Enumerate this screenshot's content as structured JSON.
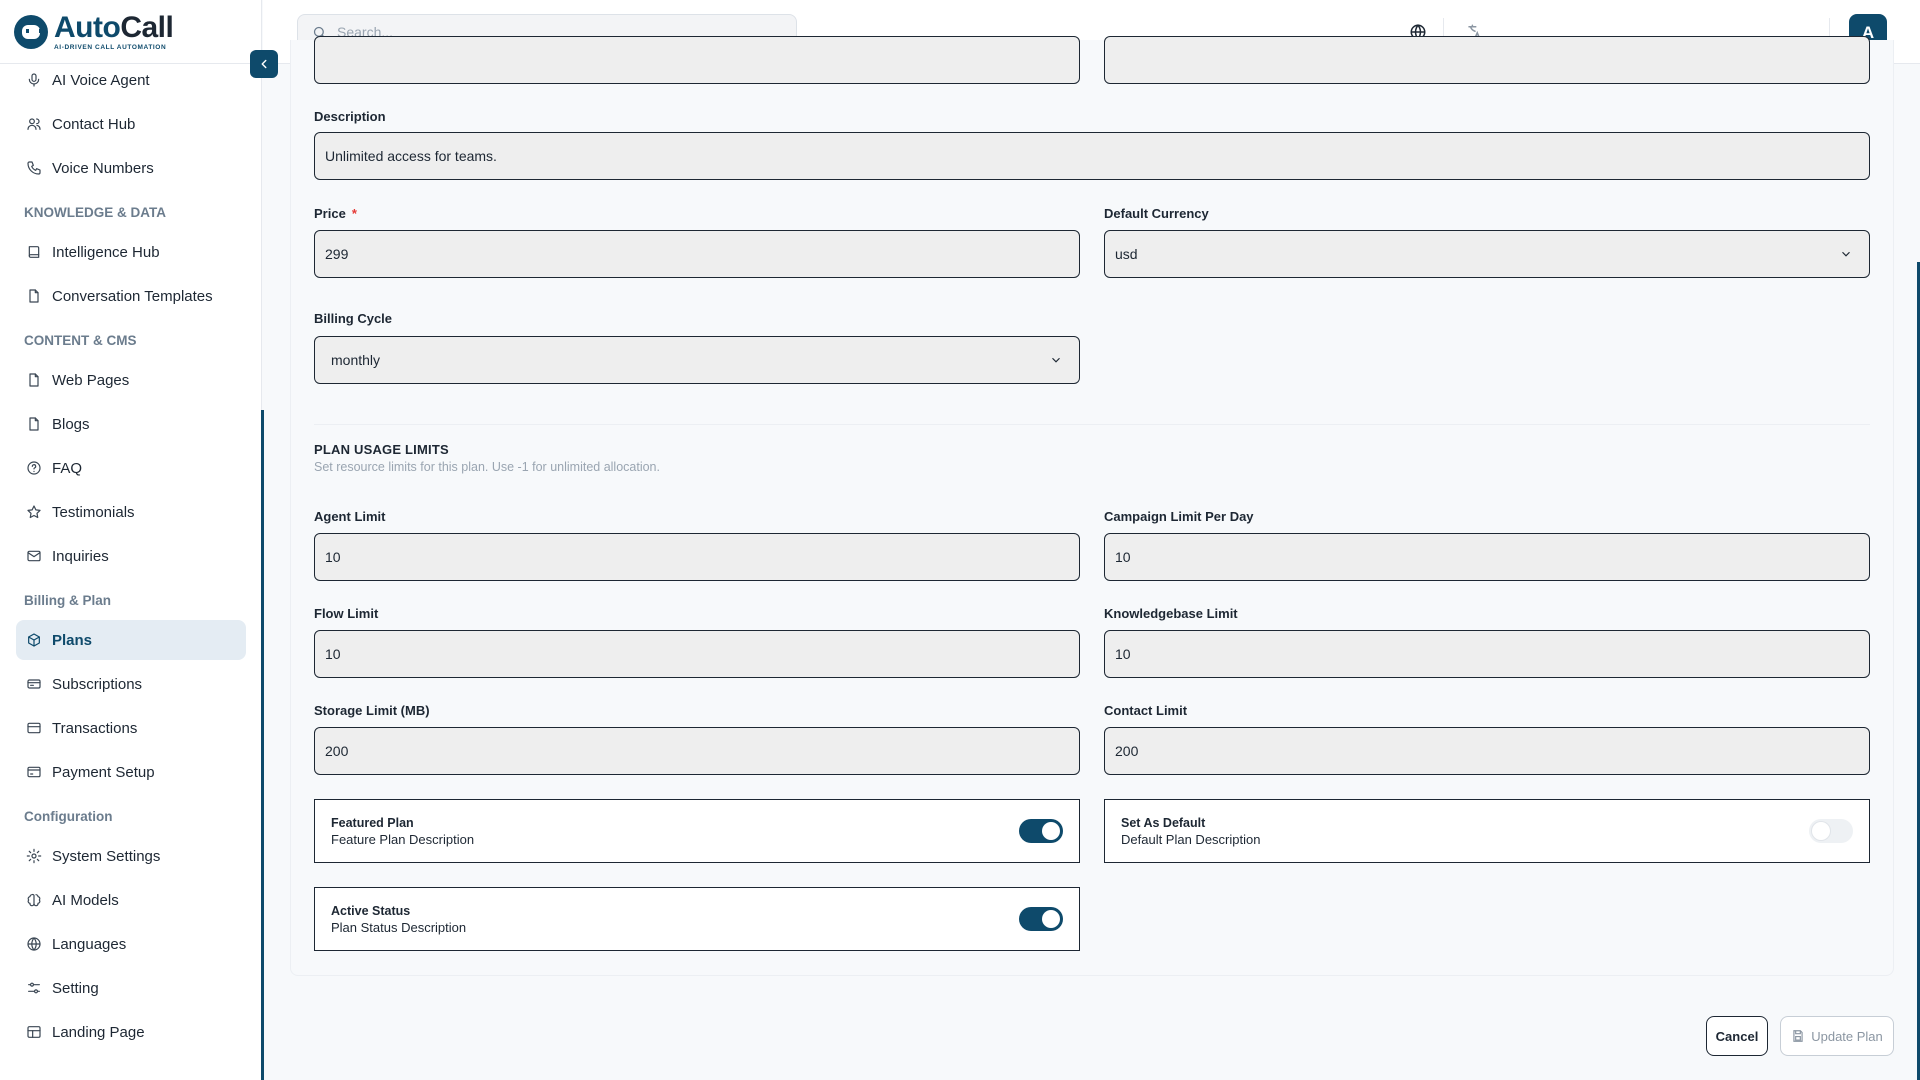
{
  "brand": {
    "name_a": "Auto",
    "name_b": "Call",
    "tagline": "AI-DRIVEN CALL AUTOMATION"
  },
  "search": {
    "placeholder": "Search..."
  },
  "user": {
    "avatar_letter": "A"
  },
  "sidebar": {
    "items": [
      {
        "type": "item",
        "label": "AI Voice Agent",
        "icon": "mic-icon"
      },
      {
        "type": "item",
        "label": "Contact Hub",
        "icon": "users-icon"
      },
      {
        "type": "item",
        "label": "Voice Numbers",
        "icon": "phone-icon"
      },
      {
        "type": "section",
        "label": "KNOWLEDGE & DATA"
      },
      {
        "type": "item",
        "label": "Intelligence Hub",
        "icon": "book-icon"
      },
      {
        "type": "item",
        "label": "Conversation Templates",
        "icon": "file-icon"
      },
      {
        "type": "section",
        "label": "CONTENT & CMS"
      },
      {
        "type": "item",
        "label": "Web Pages",
        "icon": "file-icon"
      },
      {
        "type": "item",
        "label": "Blogs",
        "icon": "file-icon"
      },
      {
        "type": "item",
        "label": "FAQ",
        "icon": "help-circle-icon"
      },
      {
        "type": "item",
        "label": "Testimonials",
        "icon": "star-icon"
      },
      {
        "type": "item",
        "label": "Inquiries",
        "icon": "mail-icon"
      },
      {
        "type": "section",
        "label": "Billing & Plan"
      },
      {
        "type": "item",
        "label": "Plans",
        "icon": "package-icon",
        "active": true
      },
      {
        "type": "item",
        "label": "Subscriptions",
        "icon": "receipt-icon"
      },
      {
        "type": "item",
        "label": "Transactions",
        "icon": "credit-card-icon"
      },
      {
        "type": "item",
        "label": "Payment Setup",
        "icon": "wallet-icon"
      },
      {
        "type": "section",
        "label": "Configuration"
      },
      {
        "type": "item",
        "label": "System Settings",
        "icon": "gear-icon"
      },
      {
        "type": "item",
        "label": "AI Models",
        "icon": "brain-icon"
      },
      {
        "type": "item",
        "label": "Languages",
        "icon": "globe-icon"
      },
      {
        "type": "item",
        "label": "Setting",
        "icon": "sliders-icon"
      },
      {
        "type": "item",
        "label": "Landing Page",
        "icon": "layout-icon"
      }
    ]
  },
  "form": {
    "description": {
      "label": "Description",
      "value": "Unlimited access for teams."
    },
    "price": {
      "label": "Price",
      "required_mark": "*",
      "value": "299"
    },
    "currency": {
      "label": "Default Currency",
      "value": "usd"
    },
    "billing_cycle": {
      "label": "Billing Cycle",
      "value": "monthly"
    },
    "usage": {
      "title": "PLAN USAGE LIMITS",
      "subtitle": "Set resource limits for this plan. Use -1 for unlimited allocation."
    },
    "agent_limit": {
      "label": "Agent Limit",
      "value": "10"
    },
    "campaign_limit": {
      "label": "Campaign Limit Per Day",
      "value": "10"
    },
    "flow_limit": {
      "label": "Flow Limit",
      "value": "10"
    },
    "kb_limit": {
      "label": "Knowledgebase Limit",
      "value": "10"
    },
    "storage_limit": {
      "label": "Storage Limit (MB)",
      "value": "200"
    },
    "contact_limit": {
      "label": "Contact Limit",
      "value": "200"
    },
    "featured": {
      "title": "Featured Plan",
      "desc": "Feature Plan Description",
      "on": true
    },
    "default": {
      "title": "Set As Default",
      "desc": "Default Plan Description",
      "on": false
    },
    "active": {
      "title": "Active Status",
      "desc": "Plan Status Description",
      "on": true
    }
  },
  "actions": {
    "cancel": "Cancel",
    "update": "Update Plan"
  },
  "colors": {
    "accent": "#0e4a6b",
    "active_bg": "#e4ecf3",
    "required": "#e53935"
  }
}
